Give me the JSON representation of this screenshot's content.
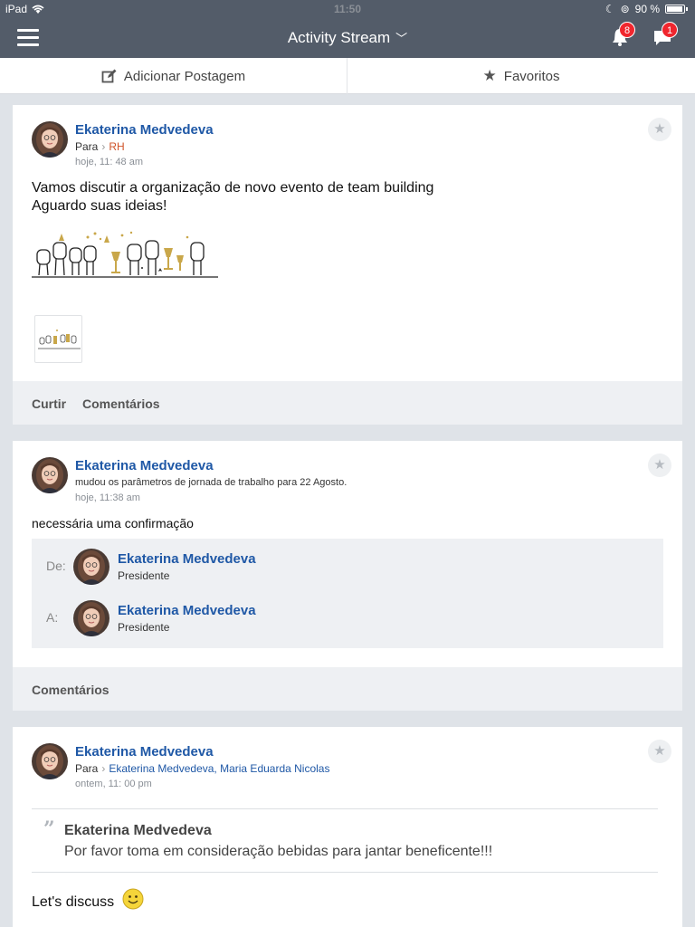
{
  "status_bar": {
    "device": "iPad",
    "time": "11:50",
    "battery": "90 %"
  },
  "nav": {
    "title": "Activity Stream",
    "notifications_count": "8",
    "messages_count": "1"
  },
  "tabs": {
    "add_post": "Adicionar Postagem",
    "favorites": "Favoritos"
  },
  "posts": [
    {
      "author": "Ekaterina Medvedeva",
      "to_label": "Para",
      "to": "RH",
      "time": "hoje, 11: 48 am",
      "lines": [
        "Vamos discutir a organização de novo evento de team building",
        "Aguardo suas ideias!"
      ],
      "actions": {
        "like": "Curtir",
        "comments": "Comentários"
      }
    },
    {
      "author": "Ekaterina Medvedeva",
      "action_text": "mudou os parâmetros de jornada de trabalho para 22 Agosto.",
      "time": "hoje, 11:38 am",
      "text": "necessária uma confirmação",
      "from_label": "De:",
      "from_name": "Ekaterina Medvedeva",
      "from_role": "Presidente",
      "to_label": "A:",
      "to_name": "Ekaterina Medvedeva",
      "to_role": "Presidente",
      "actions": {
        "comments": "Comentários"
      }
    },
    {
      "author": "Ekaterina Medvedeva",
      "to_label": "Para",
      "to": "Ekaterina Medvedeva, Maria Eduarda Nicolas",
      "time": "ontem, 11: 00 pm",
      "quote_author": "Ekaterina Medvedeva",
      "quote_text": "Por favor toma em consideração bebidas para jantar beneficente!!!",
      "text": "Let's discuss"
    }
  ],
  "colors": {
    "nav_bg": "#535c69",
    "link_blue": "#1f58a6",
    "badge_red": "#f0262e",
    "group_orange": "#d0542a"
  }
}
